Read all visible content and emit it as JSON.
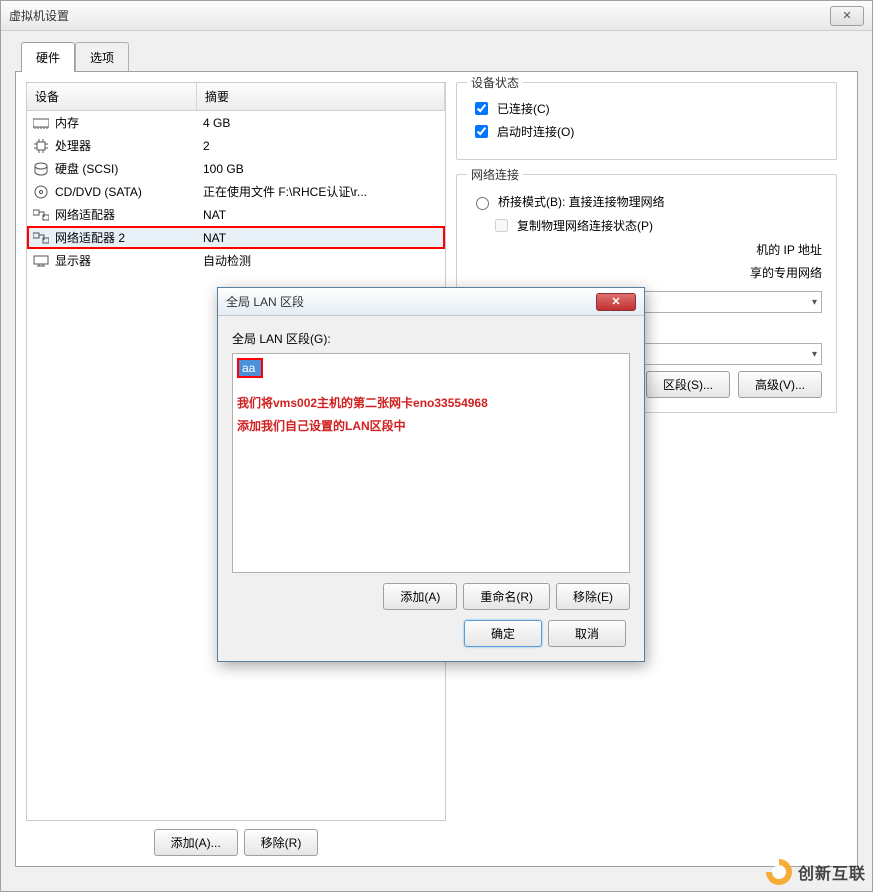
{
  "window": {
    "title": "虚拟机设置"
  },
  "tabs": {
    "hardware": "硬件",
    "options": "选项"
  },
  "table": {
    "col_device": "设备",
    "col_summary": "摘要",
    "rows": [
      {
        "icon": "memory-icon",
        "name": "内存",
        "summary": "4 GB"
      },
      {
        "icon": "cpu-icon",
        "name": "处理器",
        "summary": "2"
      },
      {
        "icon": "disk-icon",
        "name": "硬盘 (SCSI)",
        "summary": "100 GB"
      },
      {
        "icon": "cd-icon",
        "name": "CD/DVD (SATA)",
        "summary": "正在使用文件 F:\\RHCE认证\\r..."
      },
      {
        "icon": "net-icon",
        "name": "网络适配器",
        "summary": "NAT"
      },
      {
        "icon": "net-icon",
        "name": "网络适配器 2",
        "summary": "NAT",
        "highlight": true,
        "selected": true
      },
      {
        "icon": "display-icon",
        "name": "显示器",
        "summary": "自动检测"
      }
    ]
  },
  "buttons": {
    "add": "添加(A)...",
    "remove": "移除(R)"
  },
  "status_group": {
    "title": "设备状态",
    "connected": "已连接(C)",
    "connect_on_start": "启动时连接(O)"
  },
  "network_group": {
    "title": "网络连接",
    "bridged": "桥接模式(B): 直接连接物理网络",
    "replicate": "复制物理网络连接状态(P)",
    "partial_ip": "机的 IP 地址",
    "partial_net": "享的专用网络",
    "lan_segment_btn": "区段(S)...",
    "advanced_btn": "高级(V)..."
  },
  "modal": {
    "title": "全局 LAN 区段",
    "label": "全局 LAN 区段(G):",
    "item": "aa",
    "annotation_line1": "我们将vms002主机的第二张网卡eno33554968",
    "annotation_line2": "添加我们自己设置的LAN区段中",
    "add": "添加(A)",
    "rename": "重命名(R)",
    "remove": "移除(E)",
    "ok": "确定",
    "cancel": "取消"
  },
  "watermark": "创新互联"
}
